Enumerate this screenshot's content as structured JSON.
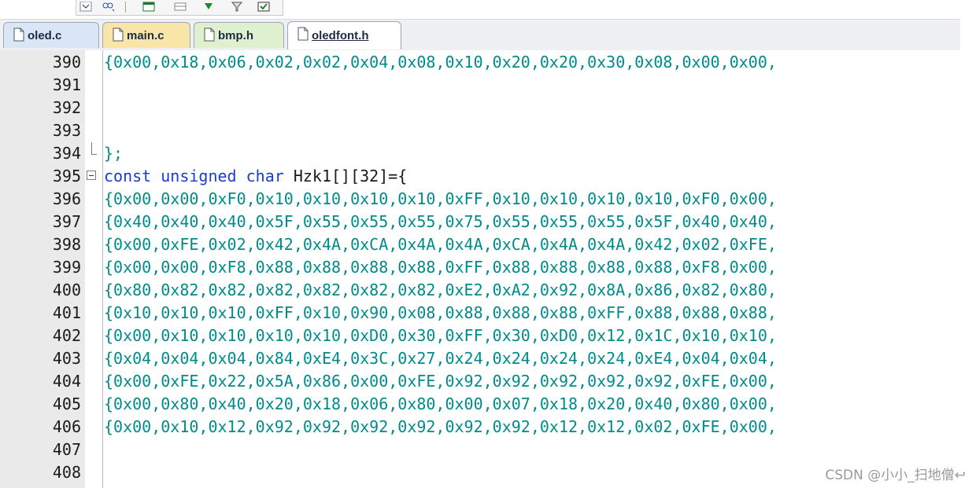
{
  "toolbar": {
    "icons": [
      "dropdown-icon",
      "find-icon",
      "window-icon",
      "layout-icon",
      "download-icon",
      "filter-icon",
      "check-window-icon"
    ]
  },
  "tabs": [
    {
      "label": "oled.c",
      "color": "#d8e6f6",
      "active": false
    },
    {
      "label": "main.c",
      "color": "#f8e6a8",
      "active": false
    },
    {
      "label": "bmp.h",
      "color": "#dff0cf",
      "active": false
    },
    {
      "label": "oledfont.h",
      "color": "#ffffff",
      "active": true
    }
  ],
  "editor": {
    "lines": [
      {
        "num": "390",
        "code": "{0x00,0x18,0x06,0x02,0x02,0x04,0x08,0x10,0x20,0x20,0x30,0x08,0x00,0x00,"
      },
      {
        "num": "391",
        "code": ""
      },
      {
        "num": "392",
        "code": ""
      },
      {
        "num": "393",
        "code": ""
      },
      {
        "num": "394",
        "code": "};"
      },
      {
        "num": "395",
        "kw1": "const",
        "kw2": "unsigned",
        "kw3": "char",
        "rest": " Hzk1[][32]={"
      },
      {
        "num": "396",
        "code": "{0x00,0x00,0xF0,0x10,0x10,0x10,0x10,0xFF,0x10,0x10,0x10,0x10,0xF0,0x00,"
      },
      {
        "num": "397",
        "code": "{0x40,0x40,0x40,0x5F,0x55,0x55,0x55,0x75,0x55,0x55,0x55,0x5F,0x40,0x40,"
      },
      {
        "num": "398",
        "code": "{0x00,0xFE,0x02,0x42,0x4A,0xCA,0x4A,0x4A,0xCA,0x4A,0x4A,0x42,0x02,0xFE,"
      },
      {
        "num": "399",
        "code": "{0x00,0x00,0xF8,0x88,0x88,0x88,0x88,0xFF,0x88,0x88,0x88,0x88,0xF8,0x00,"
      },
      {
        "num": "400",
        "code": "{0x80,0x82,0x82,0x82,0x82,0x82,0x82,0xE2,0xA2,0x92,0x8A,0x86,0x82,0x80,"
      },
      {
        "num": "401",
        "code": "{0x10,0x10,0x10,0xFF,0x10,0x90,0x08,0x88,0x88,0x88,0xFF,0x88,0x88,0x88,"
      },
      {
        "num": "402",
        "code": "{0x00,0x10,0x10,0x10,0x10,0xD0,0x30,0xFF,0x30,0xD0,0x12,0x1C,0x10,0x10,"
      },
      {
        "num": "403",
        "code": "{0x04,0x04,0x04,0x84,0xE4,0x3C,0x27,0x24,0x24,0x24,0x24,0xE4,0x04,0x04,"
      },
      {
        "num": "404",
        "code": "{0x00,0xFE,0x22,0x5A,0x86,0x00,0xFE,0x92,0x92,0x92,0x92,0x92,0xFE,0x00,"
      },
      {
        "num": "405",
        "code": "{0x00,0x80,0x40,0x20,0x18,0x06,0x80,0x00,0x07,0x18,0x20,0x40,0x80,0x00,"
      },
      {
        "num": "406",
        "code": "{0x00,0x10,0x12,0x92,0x92,0x92,0x92,0x92,0x92,0x12,0x12,0x02,0xFE,0x00,"
      },
      {
        "num": "407",
        "code": ""
      },
      {
        "num": "408",
        "code": ""
      }
    ]
  },
  "watermark": "CSDN @小小_扫地僧↩"
}
